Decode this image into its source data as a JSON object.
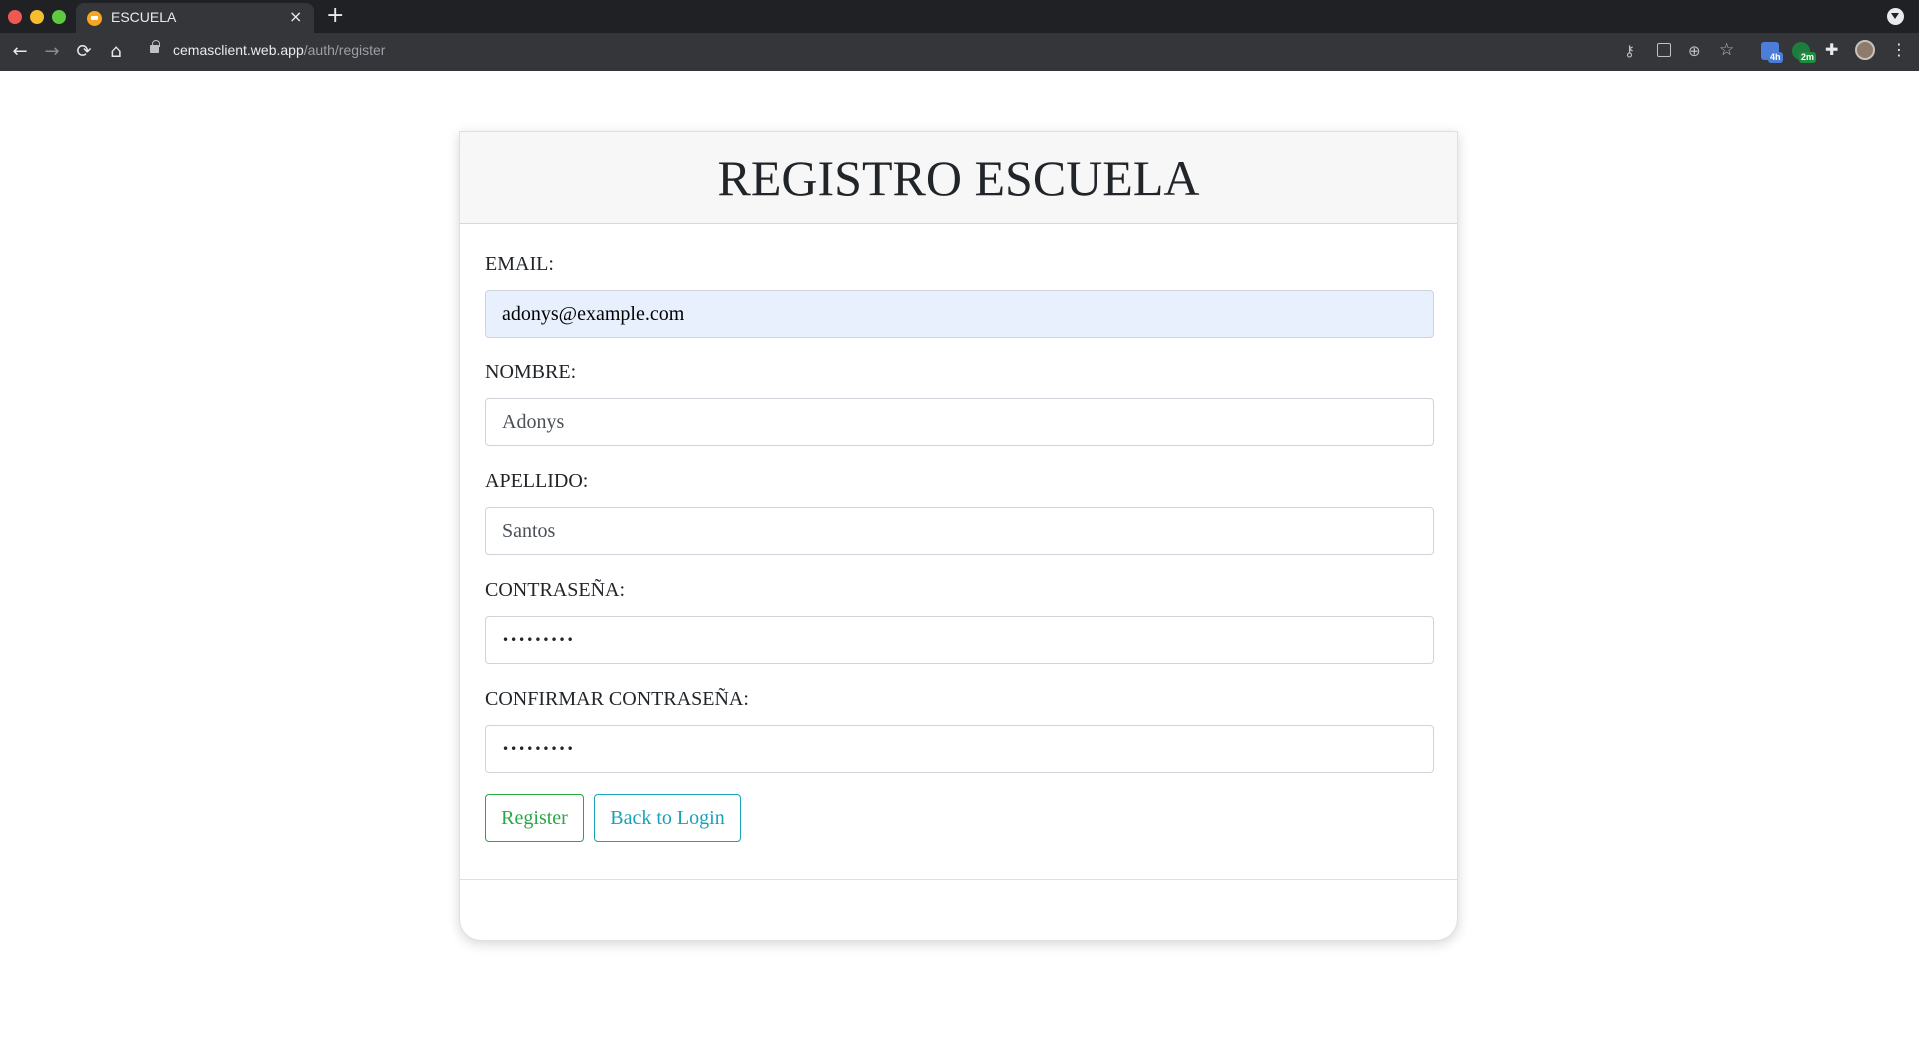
{
  "browser": {
    "tab_title": "ESCUELA",
    "tab_close": "×",
    "new_tab": "+",
    "url_host": "cemasclient.web.app",
    "url_path": "/auth/register",
    "extension_badges": [
      "4h",
      "2m"
    ],
    "icons": {
      "back": "←",
      "forward": "→",
      "reload": "⟳",
      "home": "⌂",
      "key": "⚷",
      "zoom": "⊕",
      "star": "☆",
      "puzzle": "✚",
      "menu": "⋮"
    }
  },
  "form": {
    "title": "REGISTRO ESCUELA",
    "fields": [
      {
        "label": "EMAIL:",
        "value": "adonys@example.com",
        "type": "email"
      },
      {
        "label": "NOMBRE:",
        "value": "Adonys",
        "type": "text"
      },
      {
        "label": "APELLIDO:",
        "value": "Santos",
        "type": "text"
      },
      {
        "label": "CONTRASEÑA:",
        "value": "•••••••••",
        "type": "password"
      },
      {
        "label": "CONFIRMAR CONTRASEÑA:",
        "value": "•••••••••",
        "type": "password"
      }
    ],
    "register_label": "Register",
    "back_label": "Back to Login"
  },
  "colors": {
    "register_accent": "#28a745",
    "back_accent": "#17a2b8",
    "autofill_bg": "#e8f0fe",
    "chrome_bg": "#35363a"
  }
}
